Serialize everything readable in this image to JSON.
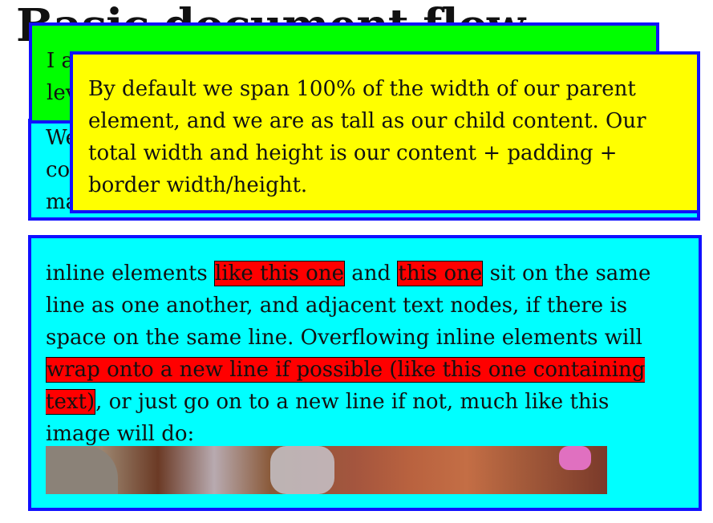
{
  "page": {
    "title": "Basic document flow"
  },
  "blocks": {
    "top_cyan_text": "We ... co... ma...",
    "green_text": "I am a basic block level element. My adjacent block level",
    "yellow_text": "By default we span 100% of the width of our parent element, and we are as tall as our child content. Our total width and height is our content + padding + border width/height."
  },
  "inline_box": {
    "t1": "inline elements ",
    "span1": "like this one",
    "t2": " and ",
    "span2": "this one",
    "t3": " sit on the same line as one another, and adjacent text nodes, if there is space on the same line. Overflowing inline elements will ",
    "span3": "wrap onto a new line if possible (like this one containing text)",
    "t4": ", or just go on to a new line if not, much like this image will do:"
  },
  "colors": {
    "cyan": "#00ffff",
    "green": "#00ff00",
    "yellow": "#ffff00",
    "red": "#ff0000",
    "border_blue": "#1010ff"
  }
}
